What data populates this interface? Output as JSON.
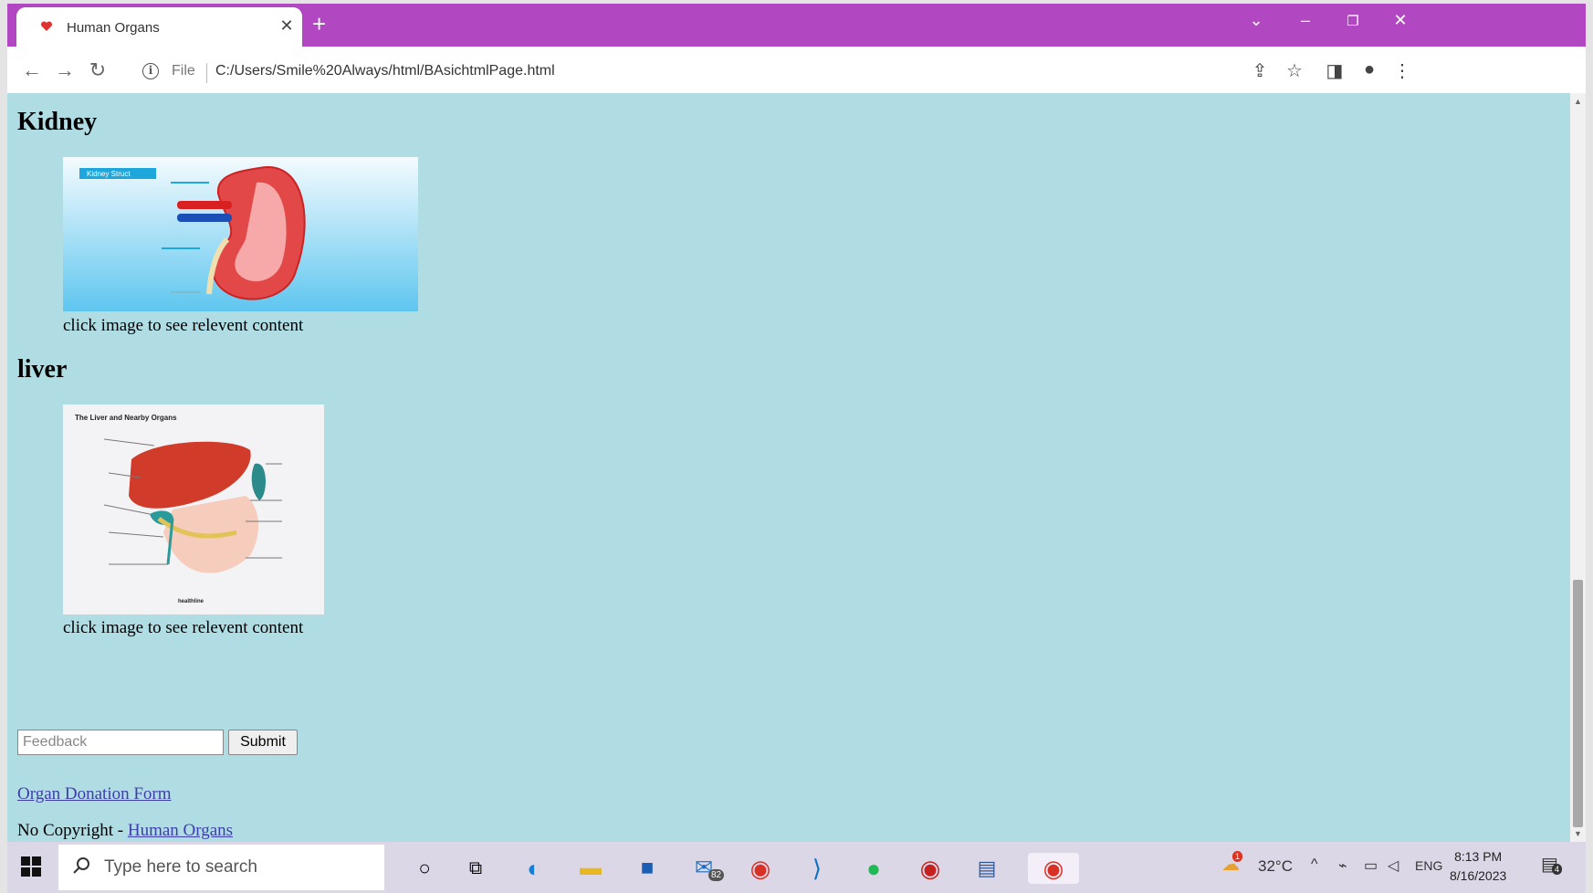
{
  "browser": {
    "tab_title": "Human Organs",
    "file_label": "File",
    "url": "C:/Users/Smile%20Always/html/BAsichtmlPage.html"
  },
  "page": {
    "sections": [
      {
        "heading": "Kidney",
        "caption": "click image to see relevent content",
        "image_label": "Kidney Struct"
      },
      {
        "heading": "liver",
        "caption": "click image to see relevent content",
        "image_label": "The Liver and Nearby Organs",
        "image_credit": "healthline"
      }
    ],
    "feedback_placeholder": "Feedback",
    "submit_label": "Submit",
    "donation_link": "Organ Donation Form",
    "footer_prefix": "No Copyright - ",
    "footer_link": "Human Organs"
  },
  "taskbar": {
    "search_placeholder": "Type here to search",
    "mail_badge": "82",
    "weather_badge": "1",
    "temperature": "32°C",
    "language": "ENG",
    "time": "8:13 PM",
    "date": "8/16/2023",
    "notification_count": "4"
  }
}
